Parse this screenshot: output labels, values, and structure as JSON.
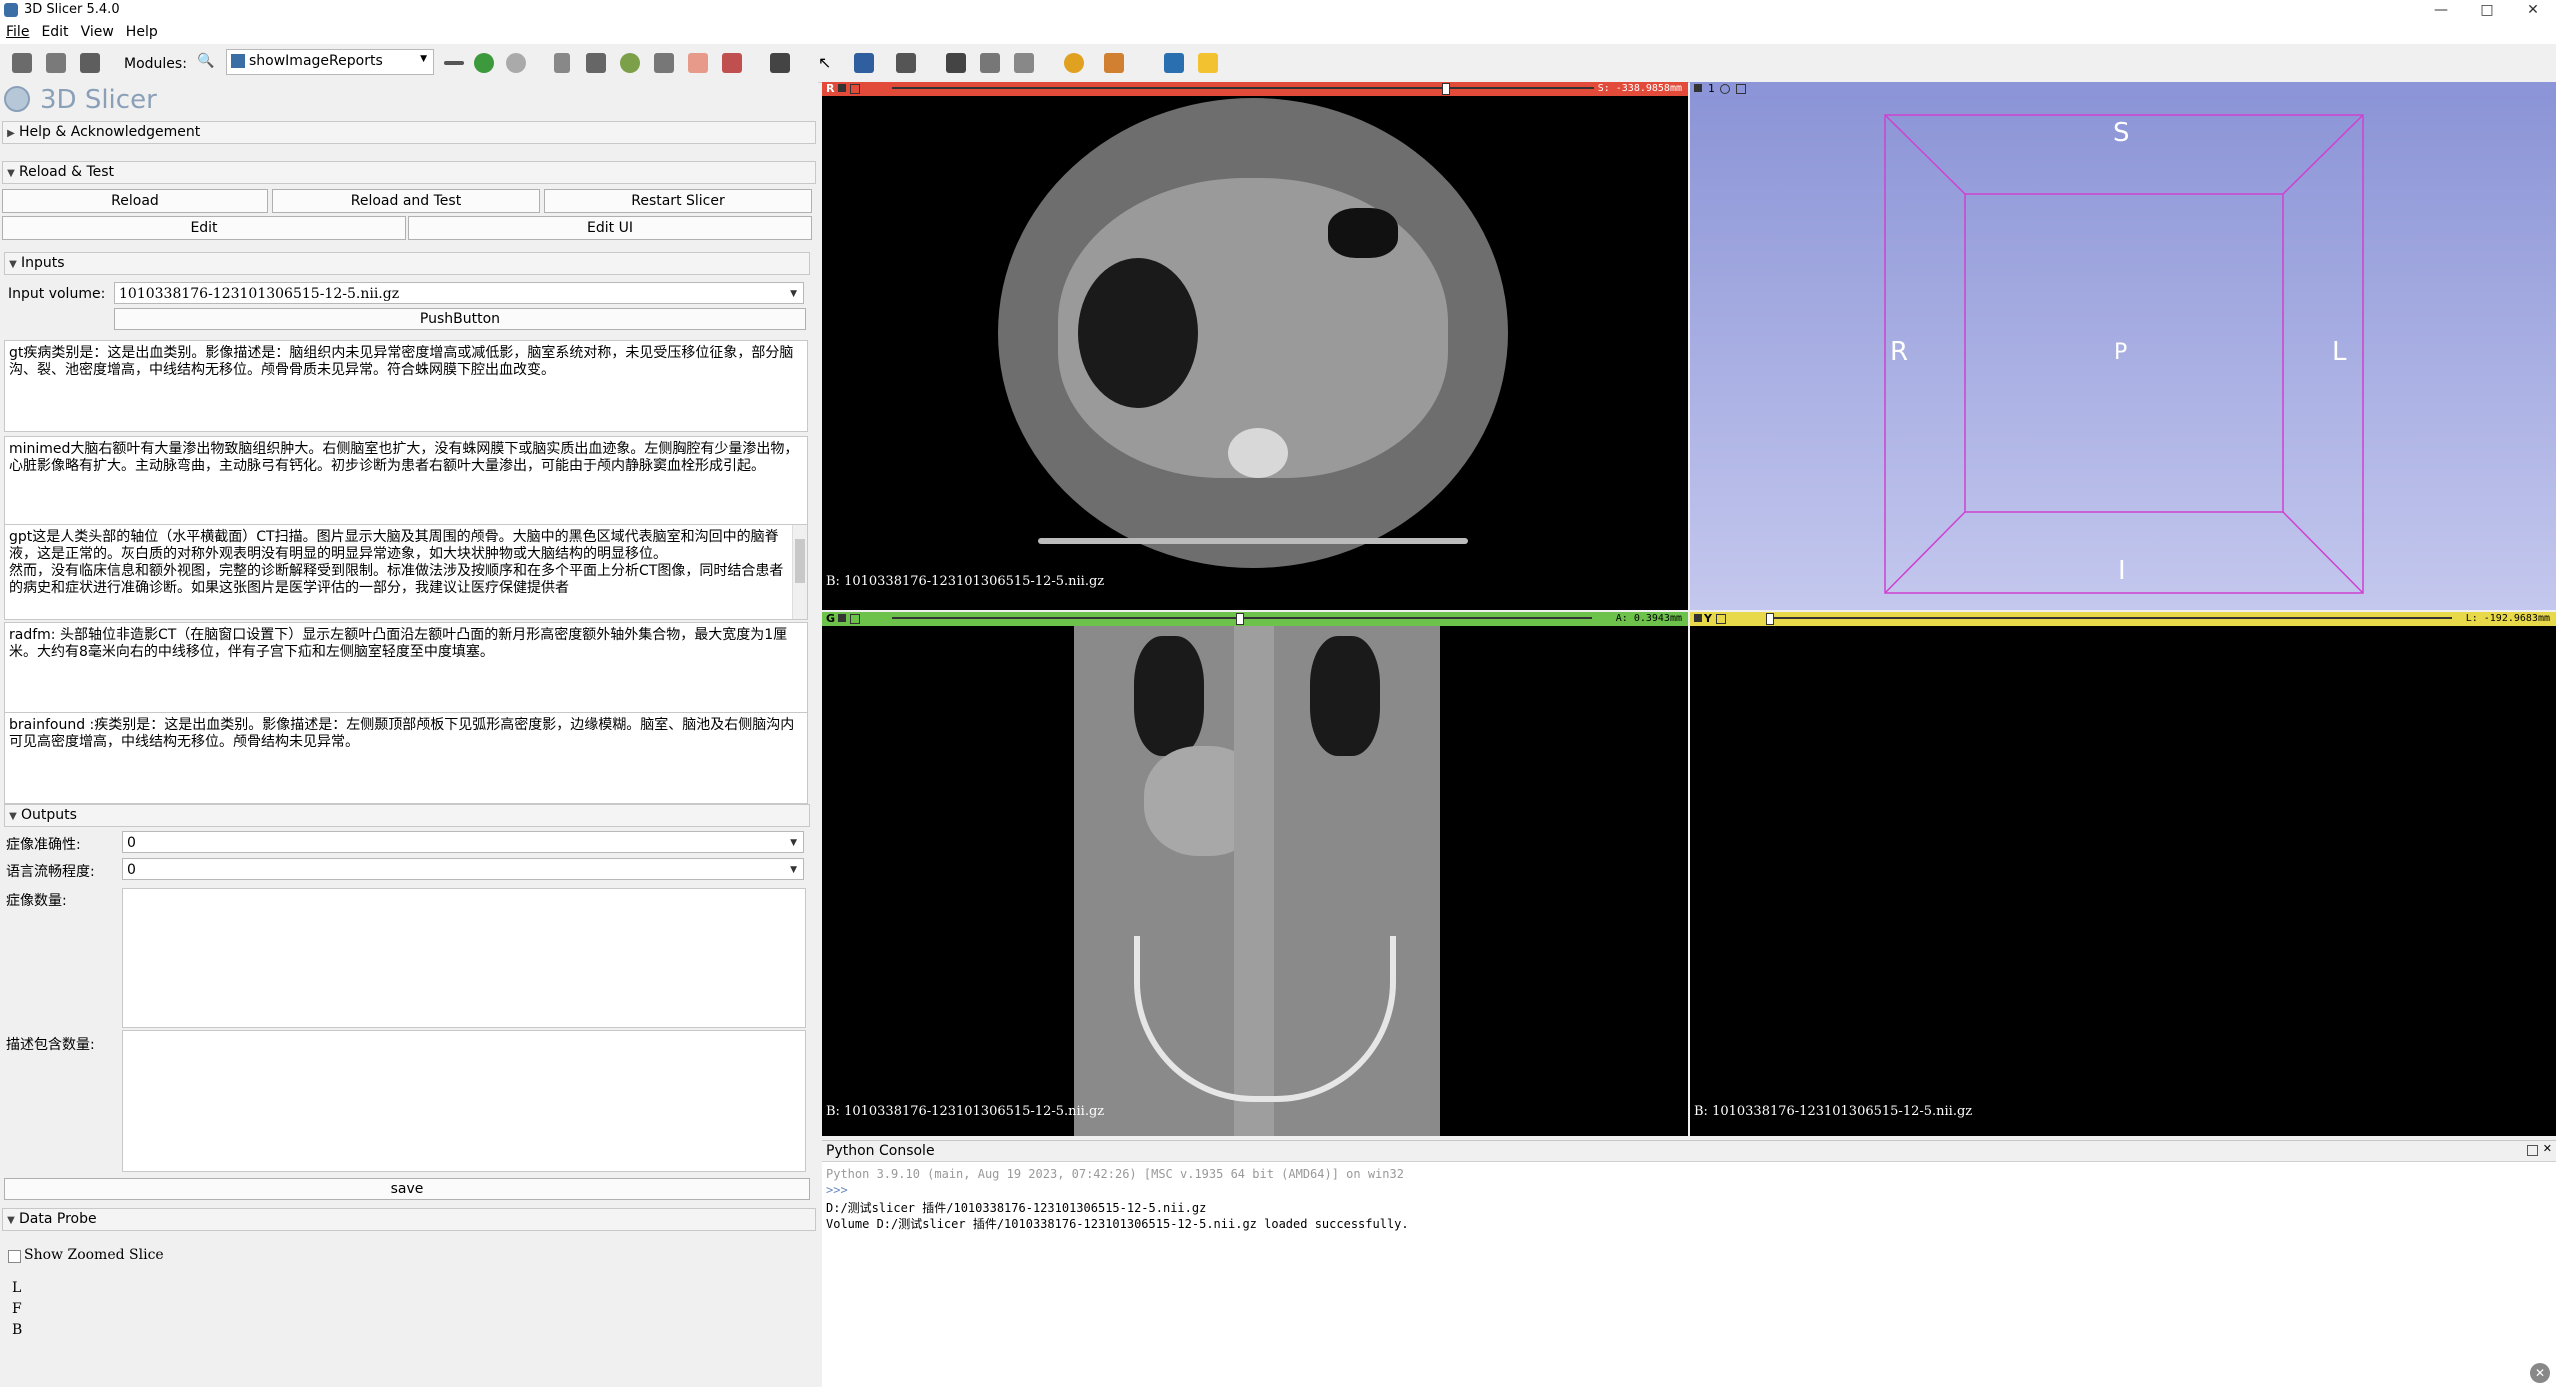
{
  "window": {
    "title": "3D Slicer 5.4.0",
    "controls": {
      "minimize": "—",
      "maximize": "□",
      "close": "✕"
    }
  },
  "menu": [
    "File",
    "Edit",
    "View",
    "Help"
  ],
  "toolbar": {
    "modules_label": "Modules:",
    "module_selected": "showImageReports"
  },
  "left": {
    "logo_text": "3D Slicer",
    "help_section": "Help & Acknowledgement",
    "reload_section": "Reload & Test",
    "reload_button": "Reload",
    "reload_test_button": "Reload and Test",
    "restart_button": "Restart Slicer",
    "edit_button": "Edit",
    "edit_ui_button": "Edit UI",
    "inputs_section": "Inputs",
    "input_volume_label": "Input volume:",
    "input_volume_value": "1010338176-123101306515-12-5.nii.gz",
    "push_button": "PushButton",
    "reports": {
      "gt": "gt疾病类别是：这是出血类别。影像描述是：脑组织内未见异常密度增高或减低影，脑室系统对称，未见受压移位征象，部分脑沟、裂、池密度增高，中线结构无移位。颅骨骨质未见异常。符合蛛网膜下腔出血改变。",
      "minimed": "minimed大脑右额叶有大量渗出物致脑组织肿大。右侧脑室也扩大，没有蛛网膜下或脑实质出血迹象。左侧胸腔有少量渗出物，心脏影像略有扩大。主动脉弯曲，主动脉弓有钙化。初步诊断为患者右额叶大量渗出，可能由于颅内静脉窦血栓形成引起。",
      "gpt": "gpt这是人类头部的轴位（水平横截面）CT扫描。图片显示大脑及其周围的颅骨。大脑中的黑色区域代表脑室和沟回中的脑脊液，这是正常的。灰白质的对称外观表明没有明显的明显异常迹象，如大块状肿物或大脑结构的明显移位。\n然而，没有临床信息和额外视图，完整的诊断解释受到限制。标准做法涉及按顺序和在多个平面上分析CT图像，同时结合患者的病史和症状进行准确诊断。如果这张图片是医学评估的一部分，我建议让医疗保健提供者",
      "radfm": "radfm: 头部轴位非造影CT（在脑窗口设置下）显示左额叶凸面沿左额叶凸面的新月形高密度额外轴外集合物，最大宽度为1厘米。大约有8毫米向右的中线移位，伴有子宫下疝和左侧脑室轻度至中度填塞。",
      "brainfound": "brainfound :疾类别是：这是出血类别。影像描述是：左侧颞顶部颅板下见弧形高密度影，边缘模糊。脑室、脑池及右侧脑沟内可见高密度增高，中线结构无移位。颅骨结构未见异常。"
    },
    "outputs_section": "Outputs",
    "accuracy_label": "症像准确性:",
    "accuracy_value": "0",
    "fluency_label": "语言流畅程度:",
    "fluency_value": "0",
    "count_label": "症像数量:",
    "desc_count_label": "描述包含数量:",
    "save_button": "save",
    "data_probe_section": "Data Probe",
    "show_zoomed_label": "Show Zoomed Slice",
    "probe_lines": [
      "L",
      "F",
      "B"
    ]
  },
  "views": {
    "red": {
      "letter": "R",
      "offset": "S: -338.9858mm",
      "background": "B: 1010338176-123101306515-12-5.nii.gz",
      "color": "#e24a3a"
    },
    "yellow": {
      "letter": "Y",
      "offset": "L: -192.9683mm",
      "background": "B: 1010338176-123101306515-12-5.nii.gz",
      "color": "#e8d94a"
    },
    "green": {
      "letter": "G",
      "offset": "A: 0.3943mm",
      "background": "B: 1010338176-123101306515-12-5.nii.gz",
      "color": "#6cc24a"
    },
    "threed": {
      "number": "1",
      "S": "S",
      "I": "I",
      "R": "R",
      "L": "L",
      "P": "P",
      "color": "#8b95d8"
    }
  },
  "console": {
    "title": "Python Console",
    "lines": [
      "Python 3.9.10 (main, Aug 19 2023, 07:42:26) [MSC v.1935 64 bit (AMD64)] on win32",
      ">>>",
      "D:/测试slicer 插件/1010338176-123101306515-12-5.nii.gz",
      "Volume D:/测试slicer 插件/1010338176-123101306515-12-5.nii.gz loaded successfully."
    ]
  }
}
